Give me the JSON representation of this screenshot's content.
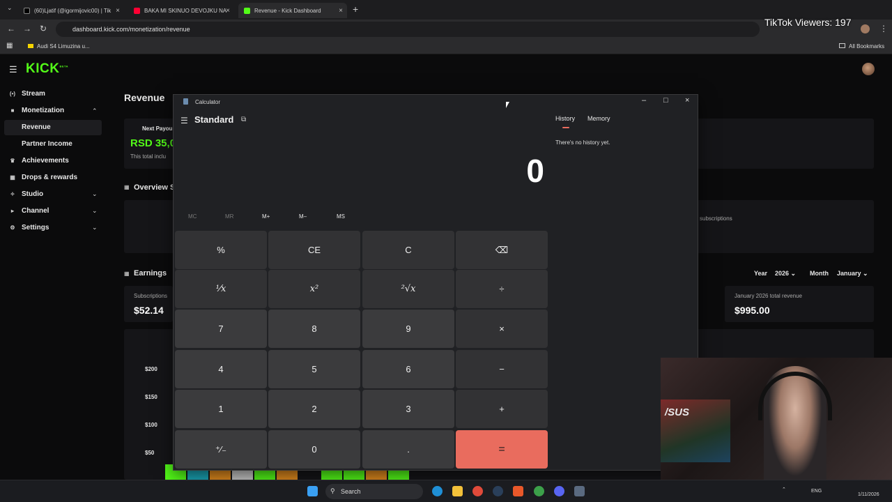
{
  "browser": {
    "tabs": [
      {
        "title": "(60)Ljatif (@igormijovic00) | Tik",
        "color": "#111111"
      },
      {
        "title": "BAKA MI SKINUO DEVOJKU NA",
        "color": "#ff0033"
      },
      {
        "title": "Revenue - Kick Dashboard",
        "color": "#53fc18"
      }
    ],
    "url": "dashboard.kick.com/monetization/revenue",
    "bookmark": "Audi S4 Limuzina u...",
    "all_bookmarks": "All Bookmarks"
  },
  "overlay": {
    "viewers": "TikTok Viewers: 197"
  },
  "kick": {
    "logo": "KICK",
    "beta": "BETA",
    "sidebar": {
      "stream": "Stream",
      "monetization": "Monetization",
      "revenue": "Revenue",
      "partner_income": "Partner Income",
      "achievements": "Achievements",
      "drops": "Drops & rewards",
      "studio": "Studio",
      "channel": "Channel",
      "settings": "Settings"
    },
    "page_title": "Revenue",
    "payout": {
      "label": "Next Payou",
      "amount": "RSD 35,0",
      "note": "This total inclu"
    },
    "overview": {
      "title": "Overview S",
      "subs_fragment": "l subscriptions"
    },
    "earnings": {
      "title": "Earnings",
      "year_label": "Year",
      "year": "2026",
      "month_label": "Month",
      "month": "January",
      "subs_label": "Subscriptions",
      "subs_value": "$52.14",
      "total_label": "January 2026 total revenue",
      "total_value": "$995.00"
    },
    "chart_ticks": [
      "$200",
      "$150",
      "$100",
      "$50"
    ]
  },
  "calculator": {
    "window_title": "Calculator",
    "mode": "Standard",
    "display": "0",
    "memory_buttons": [
      "MC",
      "MR",
      "M+",
      "M–",
      "MS"
    ],
    "keys": [
      [
        "%",
        "CE",
        "C",
        "⌫"
      ],
      [
        "¹⁄x",
        "x²",
        "²√x",
        "÷"
      ],
      [
        "7",
        "8",
        "9",
        "×"
      ],
      [
        "4",
        "5",
        "6",
        "−"
      ],
      [
        "1",
        "2",
        "3",
        "+"
      ],
      [
        "⁺⁄₋",
        "0",
        ".",
        "="
      ]
    ],
    "history_tab": "History",
    "memory_tab": "Memory",
    "history_empty": "There's no history yet.",
    "eq_color": "#e96c5e"
  },
  "webcam": {
    "brand": "/SUS"
  },
  "taskbar": {
    "search": "Search",
    "lang": "ENG",
    "date": "1/11/2026"
  }
}
